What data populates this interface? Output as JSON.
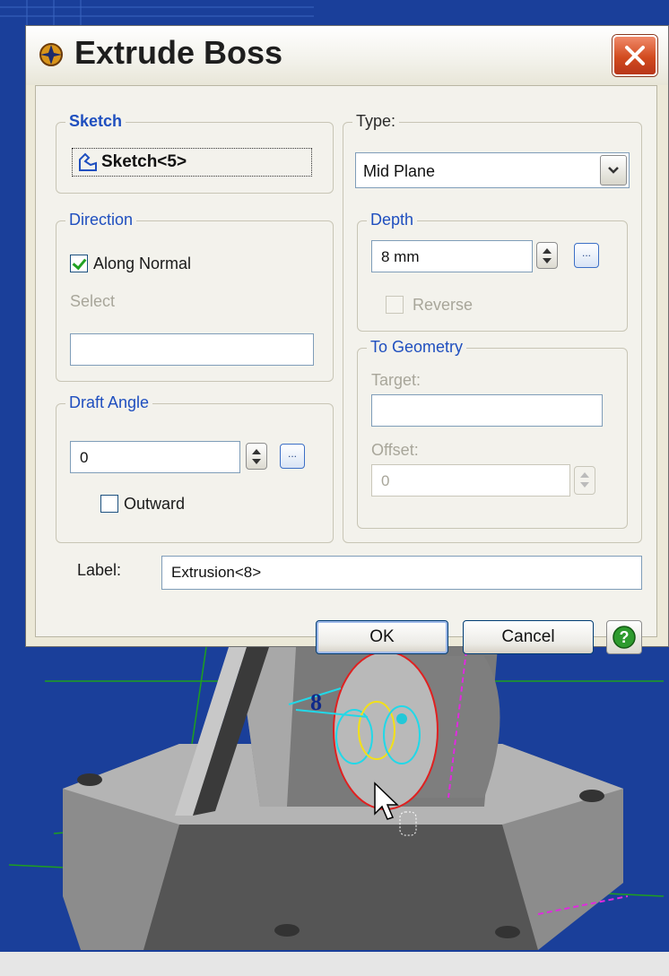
{
  "dialog": {
    "title": "Extrude Boss",
    "icon": "solidworks-logo-icon",
    "close_icon": "close-icon"
  },
  "sketch": {
    "legend": "Sketch",
    "value": "Sketch<5>",
    "icon": "sketch-icon"
  },
  "type": {
    "legend": "Type:",
    "selected": "Mid Plane"
  },
  "direction": {
    "legend": "Direction",
    "along_normal_label": "Along Normal",
    "along_normal_checked": true,
    "select_label": "Select",
    "select_value": ""
  },
  "depth": {
    "legend": "Depth",
    "value": "8 mm",
    "reverse_label": "Reverse",
    "reverse_checked": false
  },
  "to_geometry": {
    "legend": "To Geometry",
    "target_label": "Target:",
    "target_value": "",
    "offset_label": "Offset:",
    "offset_value": "0"
  },
  "draft_angle": {
    "legend": "Draft Angle",
    "value": "0",
    "outward_label": "Outward",
    "outward_checked": false
  },
  "label_field": {
    "label": "Label:",
    "value": "Extrusion<8>"
  },
  "buttons": {
    "ok": "OK",
    "cancel": "Cancel",
    "help_icon": "help-icon"
  },
  "viewport": {
    "dimension_label": "8",
    "background_color": "#1a3f9a",
    "cursor_icon": "arrow-cursor-icon"
  }
}
